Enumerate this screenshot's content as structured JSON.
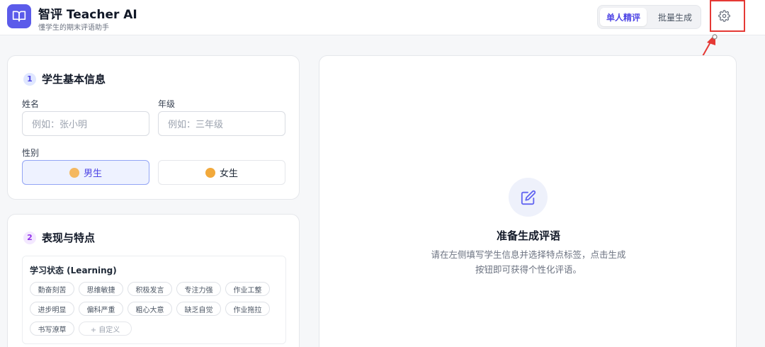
{
  "header": {
    "title": "智评 Teacher AI",
    "subtitle": "懂学生的期末评语助手",
    "logo_icon": "book-open-icon",
    "mode_tabs": [
      {
        "label": "单人精评",
        "active": true
      },
      {
        "label": "批量生成",
        "active": false
      }
    ],
    "settings_icon": "gear-icon"
  },
  "basic_info": {
    "number": "1",
    "title": "学生基本信息",
    "name_label": "姓名",
    "name_placeholder": "例如：张小明",
    "grade_label": "年级",
    "grade_placeholder": "例如：三年级",
    "gender_label": "性别",
    "gender_options": [
      {
        "label": "男生",
        "selected": true
      },
      {
        "label": "女生",
        "selected": false
      }
    ]
  },
  "traits": {
    "number": "2",
    "title": "表现与特点",
    "group_title": "学习状态 (Learning)",
    "tags": [
      "勤奋刻苦",
      "思维敏捷",
      "积极发言",
      "专注力强",
      "作业工整",
      "进步明显",
      "偏科严重",
      "粗心大意",
      "缺乏自觉",
      "作业拖拉",
      "书写潦草"
    ],
    "custom_label": "+ 自定义"
  },
  "result_panel": {
    "icon": "edit-icon",
    "title": "准备生成评语",
    "description": "请在左侧填写学生信息并选择特点标签，点击生成按钮即可获得个性化评语。"
  },
  "colors": {
    "accent": "#4f46e5",
    "logo_bg": "#5b5bea",
    "annotation_red": "#e53935"
  }
}
